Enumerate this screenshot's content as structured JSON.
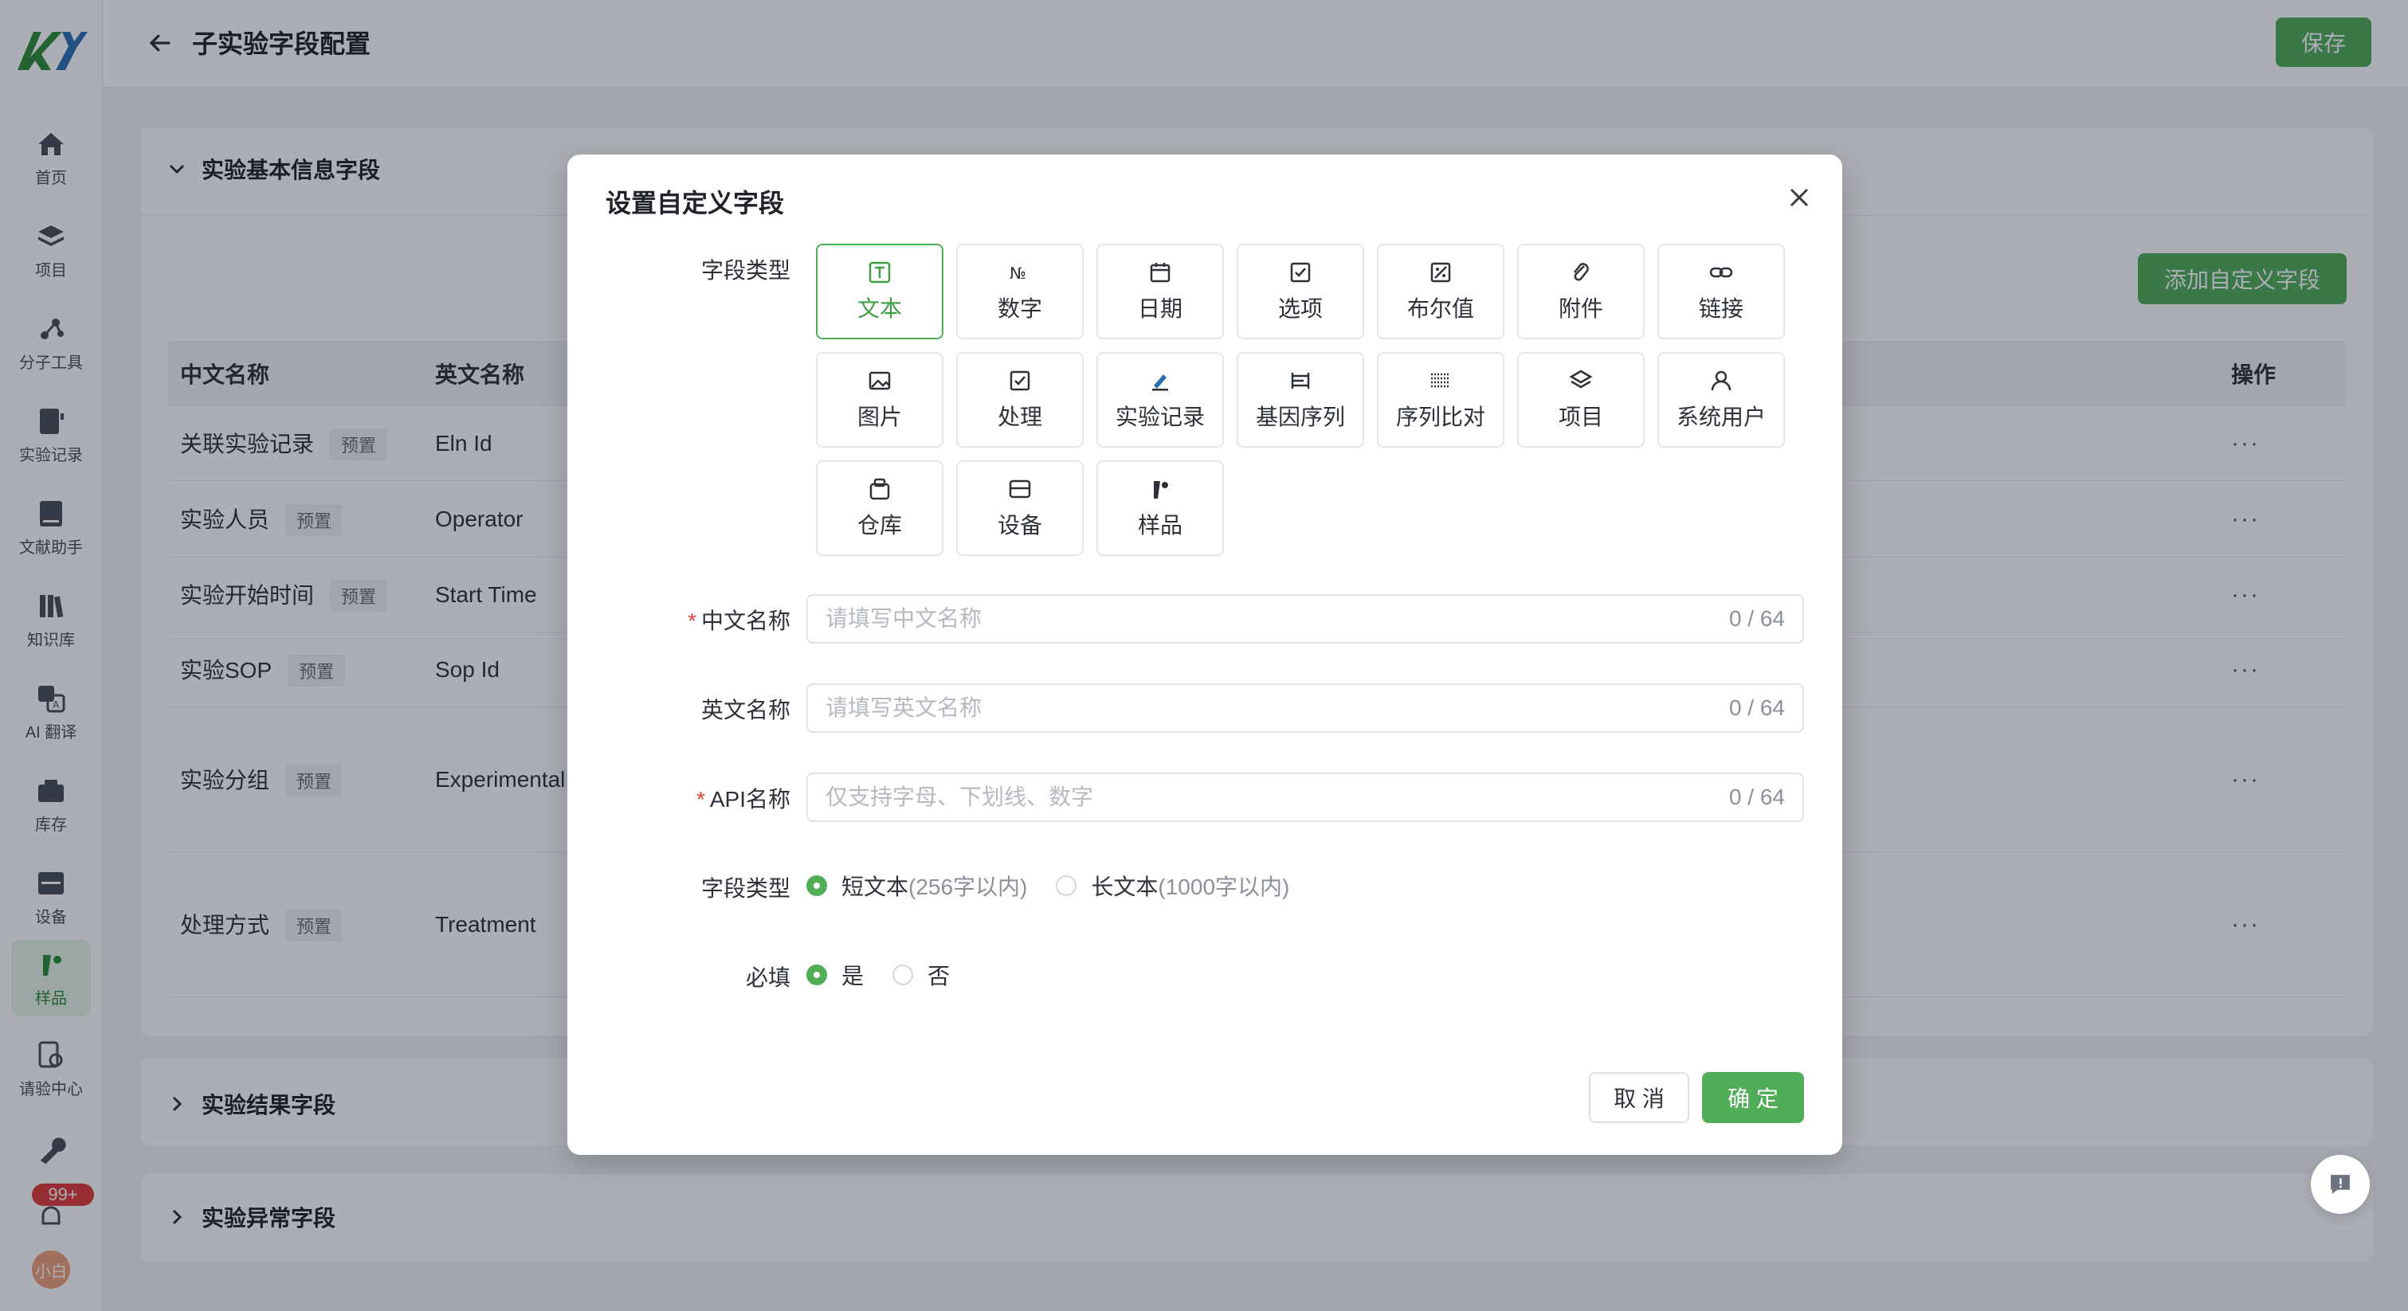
{
  "app": {
    "logo_text": "KY",
    "sidebar": [
      {
        "label": "首页",
        "icon": "home-icon"
      },
      {
        "label": "项目",
        "icon": "layers-icon"
      },
      {
        "label": "分子工具",
        "icon": "molecule-icon"
      },
      {
        "label": "实验记录",
        "icon": "notebook-icon"
      },
      {
        "label": "文献助手",
        "icon": "book-icon"
      },
      {
        "label": "知识库",
        "icon": "library-icon"
      },
      {
        "label": "AI 翻译",
        "icon": "translate-icon"
      },
      {
        "label": "库存",
        "icon": "inventory-icon"
      },
      {
        "label": "设备",
        "icon": "device-icon"
      },
      {
        "label": "样品",
        "icon": "sample-icon",
        "active": true
      },
      {
        "label": "请验中心",
        "icon": "inspection-icon"
      }
    ],
    "notification_badge": "99+",
    "avatar_text": "小白"
  },
  "header": {
    "title": "子实验字段配置",
    "save_label": "保存"
  },
  "sections": {
    "basic_title": "实验基本信息字段",
    "result_title": "实验结果字段",
    "exception_title": "实验异常字段",
    "add_field_label": "添加自定义字段"
  },
  "table": {
    "columns": [
      "中文名称",
      "英文名称",
      "操作"
    ],
    "preset_tag": "预置",
    "rows": [
      {
        "cn": "关联实验记录",
        "en": "Eln Id"
      },
      {
        "cn": "实验人员",
        "en": "Operator"
      },
      {
        "cn": "实验开始时间",
        "en": "Start Time"
      },
      {
        "cn": "实验SOP",
        "en": "Sop Id"
      },
      {
        "cn": "实验分组",
        "en": "Experimental"
      },
      {
        "cn": "处理方式",
        "en": "Treatment"
      }
    ],
    "more_label": "···"
  },
  "modal": {
    "title": "设置自定义字段",
    "field_type_label": "字段类型",
    "types": [
      {
        "label": "文本",
        "icon": "text-icon",
        "selected": true
      },
      {
        "label": "数字",
        "icon": "number-icon"
      },
      {
        "label": "日期",
        "icon": "calendar-icon"
      },
      {
        "label": "选项",
        "icon": "checkbox-icon"
      },
      {
        "label": "布尔值",
        "icon": "boolean-icon"
      },
      {
        "label": "附件",
        "icon": "paperclip-icon"
      },
      {
        "label": "链接",
        "icon": "link-icon"
      },
      {
        "label": "图片",
        "icon": "image-icon"
      },
      {
        "label": "处理",
        "icon": "process-icon"
      },
      {
        "label": "实验记录",
        "icon": "record-icon"
      },
      {
        "label": "基因序列",
        "icon": "gene-icon"
      },
      {
        "label": "序列比对",
        "icon": "alignment-icon"
      },
      {
        "label": "项目",
        "icon": "project-icon"
      },
      {
        "label": "系统用户",
        "icon": "user-icon"
      },
      {
        "label": "仓库",
        "icon": "warehouse-icon"
      },
      {
        "label": "设备",
        "icon": "equipment-icon"
      },
      {
        "label": "样品",
        "icon": "sample-icon"
      }
    ],
    "cn_name": {
      "label": "中文名称",
      "placeholder": "请填写中文名称",
      "value": "",
      "counter": "0 / 64",
      "required": true
    },
    "en_name": {
      "label": "英文名称",
      "placeholder": "请填写英文名称",
      "value": "",
      "counter": "0 / 64",
      "required": false
    },
    "api_name": {
      "label": "API名称",
      "placeholder": "仅支持字母、下划线、数字",
      "value": "",
      "counter": "0 / 64",
      "required": true
    },
    "text_type": {
      "label": "字段类型",
      "options": [
        {
          "label": "短文本",
          "hint": "(256字以内)",
          "selected": true
        },
        {
          "label": "长文本",
          "hint": "(1000字以内)",
          "selected": false
        }
      ]
    },
    "required_field": {
      "label": "必填",
      "options": [
        {
          "label": "是",
          "selected": true
        },
        {
          "label": "否",
          "selected": false
        }
      ]
    },
    "cancel_label": "取 消",
    "ok_label": "确 定"
  },
  "colors": {
    "accent": "#52ad58",
    "danger": "#e0423b"
  }
}
